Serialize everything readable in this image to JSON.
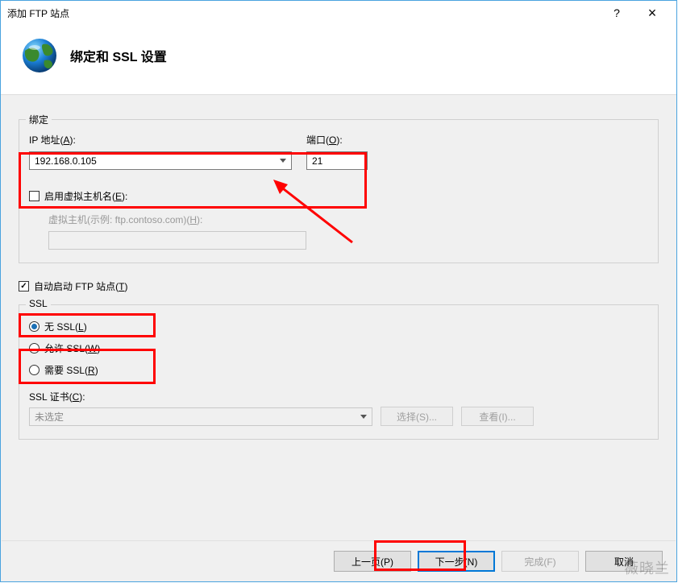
{
  "titlebar": {
    "title": "添加 FTP 站点",
    "help": "?",
    "close": "×"
  },
  "header": {
    "title": "绑定和 SSL 设置"
  },
  "binding": {
    "legend": "绑定",
    "ip_label_pre": "IP 地址(",
    "ip_label_key": "A",
    "ip_label_post": "):",
    "ip_value": "192.168.0.105",
    "port_label_pre": "端口(",
    "port_label_key": "O",
    "port_label_post": "):",
    "port_value": "21",
    "vhost_enable_pre": "启用虚拟主机名(",
    "vhost_enable_key": "E",
    "vhost_enable_post": "):",
    "vhost_label_pre": "虚拟主机(示例: ftp.contoso.com)(",
    "vhost_label_key": "H",
    "vhost_label_post": "):",
    "vhost_value": ""
  },
  "autostart": {
    "pre": "自动启动 FTP 站点(",
    "key": "T",
    "post": ")"
  },
  "ssl": {
    "legend": "SSL",
    "none_pre": "无 SSL(",
    "none_key": "L",
    "none_post": ")",
    "allow_pre": "允许 SSL(",
    "allow_key": "W",
    "allow_post": ")",
    "require_pre": "需要 SSL(",
    "require_key": "R",
    "require_post": ")",
    "cert_label_pre": "SSL 证书(",
    "cert_label_key": "C",
    "cert_label_post": "):",
    "cert_value": "未选定",
    "select_btn": "选择(S)...",
    "view_btn": "查看(I)..."
  },
  "footer": {
    "prev": "上一页(P)",
    "next": "下一步(N)",
    "finish": "完成(F)",
    "cancel": "取消"
  },
  "watermark": "薇晓兰"
}
